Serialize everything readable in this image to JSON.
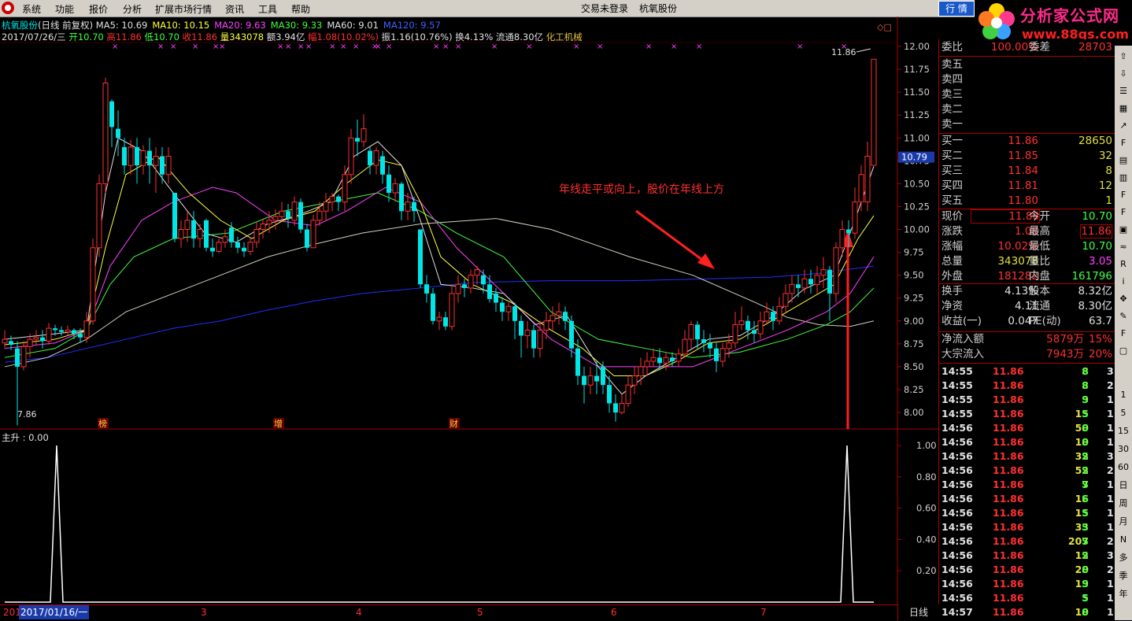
{
  "menu": {
    "items": [
      "系统",
      "功能",
      "报价",
      "分析",
      "扩展市场行情",
      "资讯",
      "工具",
      "帮助"
    ],
    "center_status": "交易未登录",
    "center_stock": "杭氧股份",
    "tab_label": "行 情"
  },
  "brand": {
    "title": "分析家公式网",
    "url": "www.88gs.com"
  },
  "header": {
    "stock": "杭氧股份",
    "mode": "(日线 前复权)",
    "ma": [
      {
        "label": "MA5: 10.69",
        "color": "#e0e0e0"
      },
      {
        "label": "MA10: 10.15",
        "color": "#ffff40"
      },
      {
        "label": "MA20: 9.63",
        "color": "#ff40ff"
      },
      {
        "label": "MA30: 9.33",
        "color": "#40ff40"
      },
      {
        "label": "MA60: 9.01",
        "color": "#e0e0e0"
      },
      {
        "label": "MA120: 9.57",
        "color": "#4060ff"
      }
    ],
    "date": "2017/07/26/三",
    "open_label": "开",
    "open": "10.70",
    "high_label": "高",
    "high": "11.86",
    "low_label": "低",
    "low": "10.70",
    "close_label": "收",
    "close": "11.86",
    "vol_label": "量",
    "vol": "343078",
    "amt_label": "额",
    "amt": "3.94亿",
    "range_label": "幅",
    "range": "1.08(10.02%)",
    "amp_label": "振",
    "amp": "1.16(10.76%)",
    "turn_label": "换",
    "turn": "4.13%",
    "float_label": "流通",
    "float": "8.30亿",
    "sector": "化工机械"
  },
  "annotation": "年线走平或向上，股价在年线上方",
  "markers": {
    "b1": "榜",
    "b2": "增",
    "b3": "财"
  },
  "indicator": {
    "label": "主升 : 0.00"
  },
  "price_axis": {
    "labels": [
      "12.00",
      "11.75",
      "11.50",
      "11.25",
      "11.00",
      "10.75",
      "10.50",
      "10.25",
      "10.00",
      "9.75",
      "9.50",
      "9.25",
      "9.00",
      "8.75",
      "8.50",
      "8.25",
      "8.00"
    ],
    "current": "10.79",
    "max_label": "11.86",
    "min_label": "7.86"
  },
  "ind_axis": {
    "labels": [
      "1.00",
      "0.80",
      "0.60",
      "0.40",
      "0.20"
    ]
  },
  "time_axis": {
    "labels": [
      "201",
      "2017/01/16/一",
      "3",
      "4",
      "5",
      "6",
      "7"
    ],
    "period": "日线"
  },
  "quote": {
    "weibi": {
      "label": "委比",
      "v": "100.00%",
      "label2": "委差",
      "v2": "28703"
    },
    "sells": [
      "卖五",
      "卖四",
      "卖三",
      "卖二",
      "卖一"
    ],
    "buys": [
      {
        "label": "买一",
        "price": "11.86",
        "vol": "28650"
      },
      {
        "label": "买二",
        "price": "11.85",
        "vol": "32"
      },
      {
        "label": "买三",
        "price": "11.84",
        "vol": "8"
      },
      {
        "label": "买四",
        "price": "11.81",
        "vol": "12"
      },
      {
        "label": "买五",
        "price": "11.80",
        "vol": "1"
      }
    ],
    "stats": [
      {
        "l1": "现价",
        "v1": "11.86",
        "c1": "#ff3030",
        "l2": "今开",
        "v2": "10.70",
        "c2": "#40ff40",
        "box1": true
      },
      {
        "l1": "涨跌",
        "v1": "1.08",
        "c1": "#ff3030",
        "l2": "最高",
        "v2": "11.86",
        "c2": "#ff3030",
        "box2": true
      },
      {
        "l1": "涨幅",
        "v1": "10.02%",
        "c1": "#ff3030",
        "l2": "最低",
        "v2": "10.70",
        "c2": "#40ff40"
      },
      {
        "l1": "总量",
        "v1": "343078",
        "c1": "#e0e040",
        "l2": "量比",
        "v2": "3.05",
        "c2": "#ff40ff"
      },
      {
        "l1": "外盘",
        "v1": "181282",
        "c1": "#ff3030",
        "l2": "内盘",
        "v2": "161796",
        "c2": "#40ff40"
      },
      {
        "l1": "换手",
        "v1": "4.13%",
        "c1": "#e0e0e0",
        "l2": "股本",
        "v2": "8.32亿",
        "c2": "#e0e0e0"
      },
      {
        "l1": "净资",
        "v1": "4.11",
        "c1": "#e0e0e0",
        "l2": "流通",
        "v2": "8.30亿",
        "c2": "#e0e0e0"
      },
      {
        "l1": "收益(一)",
        "v1": "0.047",
        "c1": "#e0e0e0",
        "l2": "PE(动)",
        "v2": "63.7",
        "c2": "#e0e0e0"
      }
    ],
    "flow": [
      {
        "label": "净流入额",
        "v": "5879万",
        "pct": "15%"
      },
      {
        "label": "大宗流入",
        "v": "7943万",
        "pct": "20%"
      }
    ],
    "ticks": [
      {
        "t": "14:55",
        "p": "11.86",
        "q": "8",
        "s": "S",
        "n": "3"
      },
      {
        "t": "14:55",
        "p": "11.86",
        "q": "8",
        "s": "S",
        "n": "2"
      },
      {
        "t": "14:55",
        "p": "11.86",
        "q": "9",
        "s": "S",
        "n": "1"
      },
      {
        "t": "14:55",
        "p": "11.86",
        "q": "15",
        "s": "S",
        "n": "1"
      },
      {
        "t": "14:56",
        "p": "11.86",
        "q": "50",
        "s": "S",
        "n": "1"
      },
      {
        "t": "14:56",
        "p": "11.86",
        "q": "10",
        "s": "S",
        "n": "1"
      },
      {
        "t": "14:56",
        "p": "11.86",
        "q": "32",
        "s": "S",
        "n": "3"
      },
      {
        "t": "14:56",
        "p": "11.86",
        "q": "52",
        "s": "S",
        "n": "2"
      },
      {
        "t": "14:56",
        "p": "11.86",
        "q": "7",
        "s": "S",
        "n": "1"
      },
      {
        "t": "14:56",
        "p": "11.86",
        "q": "16",
        "s": "S",
        "n": "1"
      },
      {
        "t": "14:56",
        "p": "11.86",
        "q": "15",
        "s": "S",
        "n": "1"
      },
      {
        "t": "14:56",
        "p": "11.86",
        "q": "33",
        "s": "S",
        "n": "1"
      },
      {
        "t": "14:56",
        "p": "11.86",
        "q": "207",
        "s": "S",
        "n": "2"
      },
      {
        "t": "14:56",
        "p": "11.86",
        "q": "12",
        "s": "S",
        "n": "3"
      },
      {
        "t": "14:56",
        "p": "11.86",
        "q": "20",
        "s": "S",
        "n": "2"
      },
      {
        "t": "14:56",
        "p": "11.86",
        "q": "19",
        "s": "S",
        "n": "1"
      },
      {
        "t": "14:56",
        "p": "11.86",
        "q": "5",
        "s": "S",
        "n": "1"
      },
      {
        "t": "14:57",
        "p": "11.86",
        "q": "10",
        "s": "S",
        "n": "1"
      }
    ]
  },
  "toolbar_labels": [
    "1",
    "5",
    "15",
    "30",
    "60",
    "日",
    "周",
    "月",
    "N",
    "多",
    "季",
    "年"
  ],
  "colors": {
    "up": "#ff3030",
    "down": "#00e5e5",
    "grid": "#a00000"
  }
}
